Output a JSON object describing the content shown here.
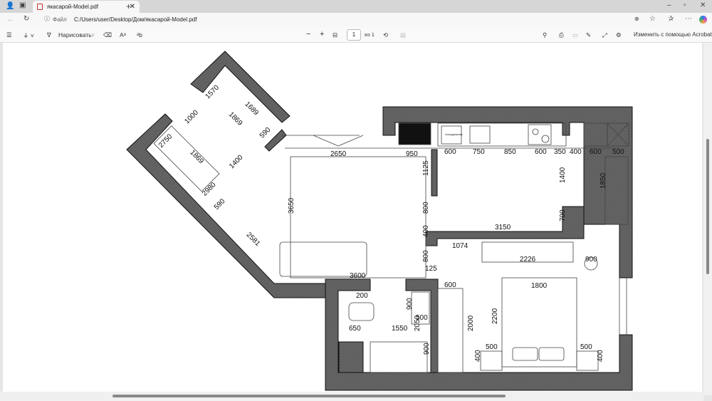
{
  "browser": {
    "tab_title": "якасарой-Model.pdf",
    "file_label": "Файл",
    "url": "C:/Users/user/Desktop/Дом/якасарой-Model.pdf"
  },
  "pdf_toolbar": {
    "draw_label": "Нарисовать",
    "page_number": "1",
    "page_total": "из 1",
    "acrobat_label": "Изменить с помощью Acrobat"
  },
  "plan": {
    "labels": [
      "1570",
      "1689",
      "1869",
      "590",
      "1000",
      "1869",
      "1400",
      "2750",
      "2980",
      "590",
      "2581",
      "3650",
      "2650",
      "950",
      "1125",
      "800",
      "400",
      "800",
      "125",
      "3600",
      "600",
      "750",
      "850",
      "600",
      "350",
      "400",
      "600",
      "500",
      "1400",
      "1850",
      "700",
      "3150",
      "1074",
      "2226",
      "900",
      "200",
      "900",
      "500",
      "650",
      "1550",
      "2050",
      "900",
      "600",
      "2000",
      "2200",
      "1800",
      "500",
      "500",
      "400",
      "400"
    ],
    "appliance_text": "Холодильник"
  }
}
